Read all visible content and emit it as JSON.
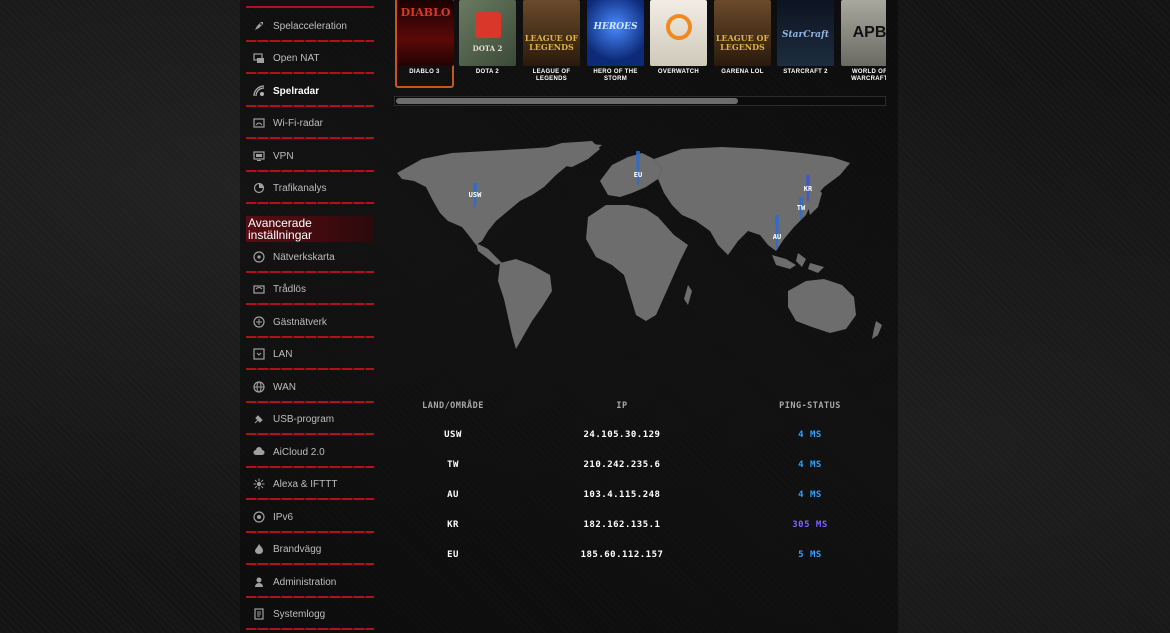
{
  "sidebar": {
    "items_top": [
      {
        "label": "Spelacceleration",
        "icon": "rocket-icon"
      },
      {
        "label": "Open NAT",
        "icon": "nat-icon"
      },
      {
        "label": "Spelradar",
        "icon": "radar-icon",
        "active": true
      },
      {
        "label": "Wi-Fi-radar",
        "icon": "wifi-radar-icon"
      },
      {
        "label": "VPN",
        "icon": "vpn-icon"
      },
      {
        "label": "Trafikanalys",
        "icon": "traffic-icon"
      }
    ],
    "section_title": "Avancerade inställningar",
    "items_advanced": [
      {
        "label": "Nätverkskarta",
        "icon": "network-map-icon"
      },
      {
        "label": "Trådlös",
        "icon": "wireless-icon"
      },
      {
        "label": "Gästnätverk",
        "icon": "guest-network-icon"
      },
      {
        "label": "LAN",
        "icon": "lan-icon"
      },
      {
        "label": "WAN",
        "icon": "globe-icon"
      },
      {
        "label": "USB-program",
        "icon": "usb-icon"
      },
      {
        "label": "AiCloud 2.0",
        "icon": "cloud-icon"
      },
      {
        "label": "Alexa & IFTTT",
        "icon": "alexa-icon"
      },
      {
        "label": "IPv6",
        "icon": "ipv6-icon"
      },
      {
        "label": "Brandvägg",
        "icon": "firewall-icon"
      },
      {
        "label": "Administration",
        "icon": "admin-icon"
      },
      {
        "label": "Systemlogg",
        "icon": "log-icon"
      }
    ]
  },
  "games": [
    {
      "title": "DIABLO 3",
      "cover_text": "DIABLO",
      "bg": "#3a0605",
      "fg": "#d83a22",
      "selected": true
    },
    {
      "title": "DOTA 2",
      "cover_text": "DOTA 2",
      "bg": "#4a5a48",
      "fg": "#e03a2a"
    },
    {
      "title": "LEAGUE OF LEGENDS",
      "cover_text": "LEAGUE OF LEGENDS",
      "bg": "#3b2a18",
      "fg": "#e0b24a"
    },
    {
      "title": "HERO OF THE STORM",
      "cover_text": "HEROES",
      "bg": "#1a3a8a",
      "fg": "#9fd0ff"
    },
    {
      "title": "OVERWATCH",
      "cover_text": "",
      "bg": "#e8e2d8",
      "fg": "#f08a20"
    },
    {
      "title": "GARENA LOL",
      "cover_text": "LEAGUE OF LEGENDS",
      "bg": "#3b2a18",
      "fg": "#e0b24a"
    },
    {
      "title": "STARCRAFT 2",
      "cover_text": "StarCraft",
      "bg": "#121c2a",
      "fg": "#8fb5e0"
    },
    {
      "title": "WORLD OF WARCRAFT",
      "cover_text": "APB",
      "bg": "#8a8a80",
      "fg": "#111111"
    }
  ],
  "scroll": {
    "position_fraction": 0.7
  },
  "map": {
    "land_color": "#6d6d6d",
    "servers": [
      {
        "label": "USW"
      },
      {
        "label": "EU"
      },
      {
        "label": "KR"
      },
      {
        "label": "TW"
      },
      {
        "label": "AU"
      }
    ]
  },
  "table": {
    "headers": [
      "LAND/OMRÅDE",
      "IP",
      "PING-STATUS"
    ],
    "rows": [
      {
        "region": "USW",
        "ip": "24.105.30.129",
        "ping": "4 MS",
        "status": "good"
      },
      {
        "region": "TW",
        "ip": "210.242.235.6",
        "ping": "4 MS",
        "status": "good"
      },
      {
        "region": "AU",
        "ip": "103.4.115.248",
        "ping": "4 MS",
        "status": "good"
      },
      {
        "region": "KR",
        "ip": "182.162.135.1",
        "ping": "305 MS",
        "status": "bad"
      },
      {
        "region": "EU",
        "ip": "185.60.112.157",
        "ping": "5 MS",
        "status": "good"
      }
    ]
  },
  "colors": {
    "accent": "#b0111d",
    "ping_good": "#2aa3ff",
    "ping_bad": "#7e62ff",
    "selected_border": "#c8551a"
  }
}
